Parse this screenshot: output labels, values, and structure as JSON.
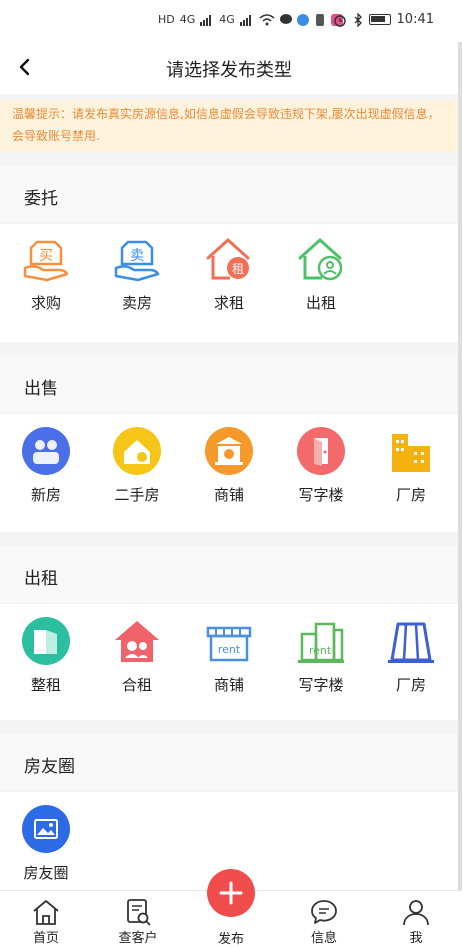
{
  "status_bar": {
    "time": "10:41",
    "left_glyphs": [
      "HD",
      "4G",
      "4G"
    ],
    "right_glyphs": [
      "alarm-icon",
      "bluetooth-icon"
    ]
  },
  "header": {
    "title": "请选择发布类型",
    "back_icon": "chevron-left-icon"
  },
  "notice": {
    "text": "温馨提示：请发布真实房源信息,如信息虚假会导致违规下架,屡次出现虚假信息，会导致账号禁用."
  },
  "sections": {
    "entrust": {
      "title": "委托",
      "items": [
        {
          "label": "求购",
          "icon": "buy-icon",
          "color": "#f5913d"
        },
        {
          "label": "卖房",
          "icon": "sell-icon",
          "color": "#3a8ee6"
        },
        {
          "label": "求租",
          "icon": "seek-rent-icon",
          "color": "#f26e55"
        },
        {
          "label": "出租",
          "icon": "rent-out-icon",
          "color": "#4fc06a"
        }
      ]
    },
    "sale": {
      "title": "出售",
      "items": [
        {
          "label": "新房",
          "icon": "new-house-icon",
          "color": "#4a6fe8"
        },
        {
          "label": "二手房",
          "icon": "second-hand-house-icon",
          "color": "#f5c518"
        },
        {
          "label": "商铺",
          "icon": "shop-icon",
          "color": "#f59a2a"
        },
        {
          "label": "写字楼",
          "icon": "office-icon",
          "color": "#f26a6a"
        },
        {
          "label": "厂房",
          "icon": "factory-icon",
          "color": "#f5b20e"
        }
      ]
    },
    "rent": {
      "title": "出租",
      "items": [
        {
          "label": "整租",
          "icon": "whole-rent-icon",
          "color": "#2bbf9f"
        },
        {
          "label": "合租",
          "icon": "shared-rent-icon",
          "color": "#f0636b"
        },
        {
          "label": "商铺",
          "icon": "shop-rent-icon",
          "color": "#4a90e2"
        },
        {
          "label": "写字楼",
          "icon": "office-rent-icon",
          "color": "#5cb85c"
        },
        {
          "label": "厂房",
          "icon": "factory-rent-icon",
          "color": "#3d5fd6"
        }
      ]
    },
    "circle": {
      "title": "房友圈",
      "items": [
        {
          "label": "房友圈",
          "icon": "photo-icon",
          "color": "#2d6be6"
        }
      ]
    }
  },
  "tab_bar": {
    "home": "首页",
    "customers": "查客户",
    "publish": "发布",
    "messages": "信息",
    "me": "我",
    "publish_color": "#f04c4c"
  }
}
